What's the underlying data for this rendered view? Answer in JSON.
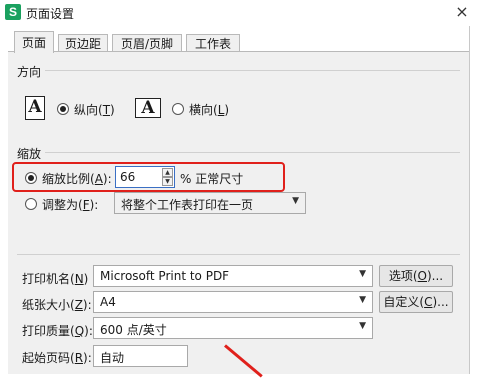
{
  "window": {
    "app_icon_letter": "S",
    "title": "页面设置",
    "close": "×"
  },
  "tabs": [
    {
      "label": "页面"
    },
    {
      "label": "页边距"
    },
    {
      "label": "页眉/页脚"
    },
    {
      "label": "工作表"
    }
  ],
  "orientation": {
    "section_label": "方向",
    "icon_letter": "A",
    "portrait": {
      "label": "纵向(",
      "key": "T",
      "suffix": ")",
      "selected": true
    },
    "landscape": {
      "label": "横向(",
      "key": "L",
      "suffix": ")",
      "selected": false
    }
  },
  "scaling": {
    "section_label": "缩放",
    "scale": {
      "label": "缩放比例(",
      "key": "A",
      "suffix": "):",
      "value": "66",
      "unit_text": "% 正常尺寸",
      "selected": true
    },
    "fit": {
      "label": "调整为(",
      "key": "F",
      "suffix": "):",
      "option": "将整个工作表打印在一页",
      "selected": false
    }
  },
  "printer": {
    "printer_name": {
      "label": "打印机名(",
      "key": "N",
      "suffix": ")",
      "value": "Microsoft Print to PDF",
      "button": "选项(",
      "button_key": "O",
      "button_suffix": ")..."
    },
    "paper_size": {
      "label": "纸张大小(",
      "key": "Z",
      "suffix": "):",
      "value": "A4",
      "button": "自定义(",
      "button_key": "C",
      "button_suffix": ")..."
    },
    "print_quality": {
      "label": "打印质量(",
      "key": "Q",
      "suffix": "):",
      "value": "600 点/英寸"
    },
    "first_page": {
      "label": "起始页码(",
      "key": "R",
      "suffix": "):",
      "value": "自动"
    }
  },
  "colors": {
    "highlight": "#e0201b",
    "app_icon": "#1aa15f"
  }
}
